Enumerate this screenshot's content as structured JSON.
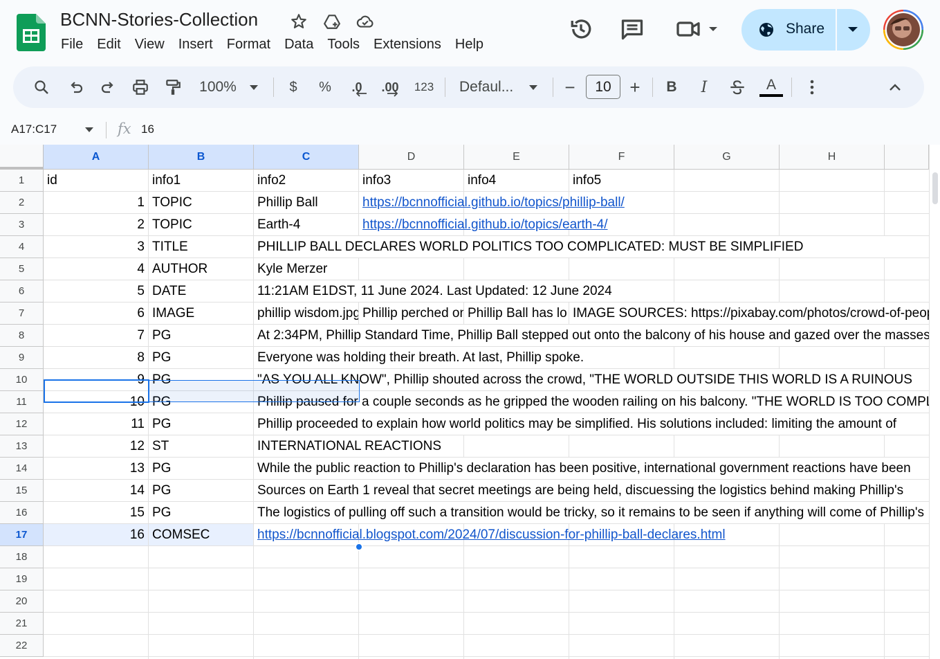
{
  "doc": {
    "title": "BCNN-Stories-Collection",
    "menu": [
      "File",
      "Edit",
      "View",
      "Insert",
      "Format",
      "Data",
      "Tools",
      "Extensions",
      "Help"
    ],
    "share_label": "Share"
  },
  "toolbar": {
    "zoom": "100%",
    "currency": "$",
    "percent": "%",
    "dec_decrease": ".0",
    "dec_increase": ".00",
    "number_format": "123",
    "font": "Defaul...",
    "font_size": "10",
    "minus": "−",
    "plus": "+",
    "bold": "B",
    "italic": "I",
    "text_color": "A"
  },
  "formula_bar": {
    "name_box": "A17:C17",
    "fx": "fx",
    "value": "16"
  },
  "columns": [
    "A",
    "B",
    "C",
    "D",
    "E",
    "F",
    "G",
    "H"
  ],
  "rows": [
    "1",
    "2",
    "3",
    "4",
    "5",
    "6",
    "7",
    "8",
    "9",
    "10",
    "11",
    "12",
    "13",
    "14",
    "15",
    "16",
    "17",
    "18",
    "19",
    "20",
    "21",
    "22"
  ],
  "cells": {
    "r1": {
      "a": "id",
      "b": "info1",
      "c": "info2",
      "d": "info3",
      "e": "info4",
      "f": "info5"
    },
    "r2": {
      "a": "1",
      "b": "TOPIC",
      "c": "Phillip Ball",
      "d": "https://bcnnofficial.github.io/topics/phillip-ball/"
    },
    "r3": {
      "a": "2",
      "b": "TOPIC",
      "c": "Earth-4",
      "d": "https://bcnnofficial.github.io/topics/earth-4/"
    },
    "r4": {
      "a": "3",
      "b": "TITLE",
      "c": "PHILLIP BALL DECLARES WORLD POLITICS TOO COMPLICATED: MUST BE SIMPLIFIED"
    },
    "r5": {
      "a": "4",
      "b": "AUTHOR",
      "c": "Kyle Merzer"
    },
    "r6": {
      "a": "5",
      "b": "DATE",
      "c": "11:21AM E1DST, 11 June 2024. Last Updated: 12 June 2024"
    },
    "r7": {
      "a": "6",
      "b": "IMAGE",
      "c": "phillip wisdom.jpg",
      "d": "Phillip perched on",
      "e": "Phillip Ball has lo",
      "f": "IMAGE SOURCES: https://pixabay.com/photos/crowd-of-people"
    },
    "r8": {
      "a": "7",
      "b": "PG",
      "c": "At 2:34PM, Phillip Standard Time, Phillip Ball stepped out onto the balcony of his house and gazed over the masses"
    },
    "r9": {
      "a": "8",
      "b": "PG",
      "c": "Everyone was holding their breath. At last, Phillip spoke."
    },
    "r10": {
      "a": "9",
      "b": "PG",
      "c": "\"AS YOU ALL KNOW\", Phillip shouted across the crowd, \"THE WORLD OUTSIDE THIS WORLD IS A RUINOUS"
    },
    "r11": {
      "a": "10",
      "b": "PG",
      "c": "Phillip paused for a couple seconds as he gripped the wooden railing on his balcony. \"THE WORLD IS TOO COMPLICATED"
    },
    "r12": {
      "a": "11",
      "b": "PG",
      "c": "Phillip proceeded to explain how world politics may be simplified. His solutions included: limiting the amount of"
    },
    "r13": {
      "a": "12",
      "b": "ST",
      "c": "INTERNATIONAL REACTIONS"
    },
    "r14": {
      "a": "13",
      "b": "PG",
      "c": "While the public reaction to Phillip's declaration has been positive, international government reactions have been"
    },
    "r15": {
      "a": "14",
      "b": "PG",
      "c": "Sources on Earth 1 reveal that secret meetings are being held, discuessing the logistics behind making Phillip's"
    },
    "r16": {
      "a": "15",
      "b": "PG",
      "c": "The logistics of pulling off such a transition would be tricky, so it remains to be seen if anything will come of Phillip's"
    },
    "r17": {
      "a": "16",
      "b": "COMSEC",
      "c": "https://bcnnofficial.blogspot.com/2024/07/discussion-for-phillip-ball-declares.html"
    }
  }
}
